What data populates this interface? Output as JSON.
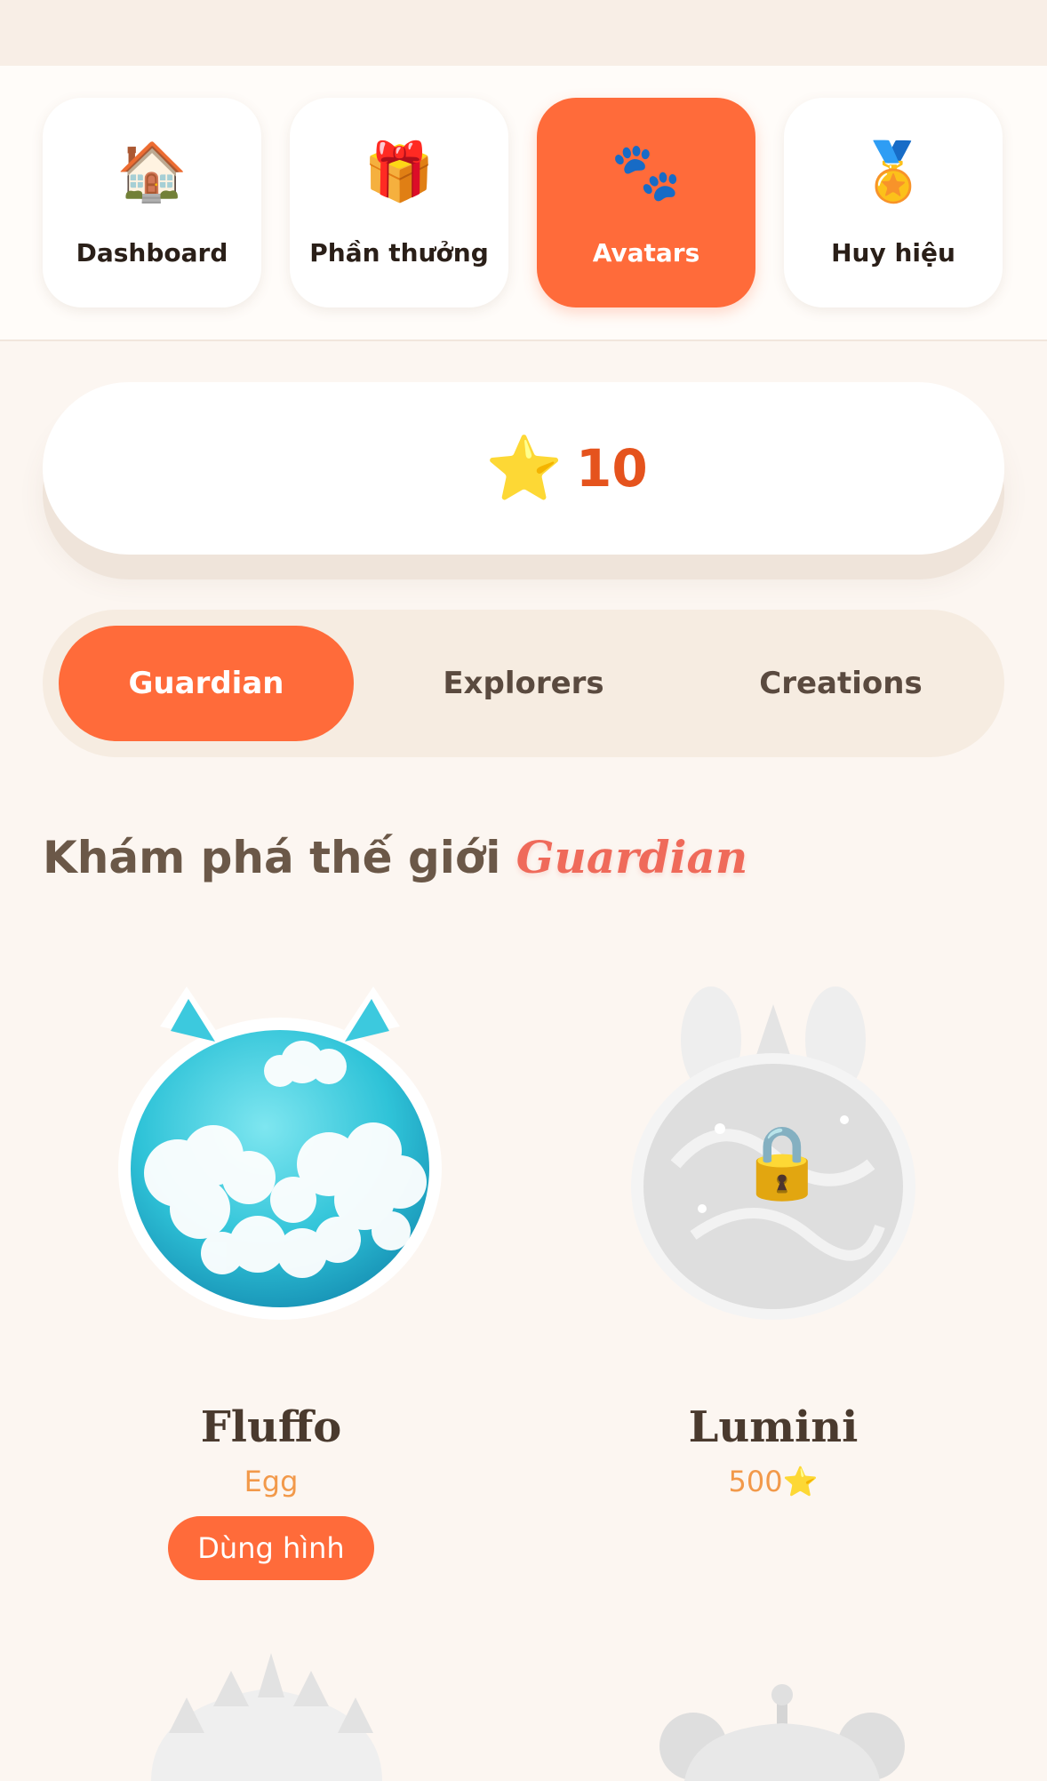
{
  "nav": {
    "items": [
      {
        "label": "Dashboard",
        "icon": "🏠",
        "icon_name": "house-icon",
        "active": false
      },
      {
        "label": "Phần thưởng",
        "icon": "🎁",
        "icon_name": "gift-icon",
        "active": false
      },
      {
        "label": "Avatars",
        "icon": "🐾",
        "icon_name": "paw-prints-icon",
        "active": true
      },
      {
        "label": "Huy hiệu",
        "icon": "🏅",
        "icon_name": "medal-icon",
        "active": false
      }
    ]
  },
  "stars": {
    "icon": "⭐",
    "icon_name": "star-icon",
    "count": "10"
  },
  "tabs": [
    {
      "label": "Guardian",
      "active": true
    },
    {
      "label": "Explorers",
      "active": false
    },
    {
      "label": "Creations",
      "active": false
    }
  ],
  "section": {
    "title_prefix": "Khám phá thế giới",
    "title_accent": "Guardian"
  },
  "avatars": [
    {
      "name": "Fluffo",
      "subtitle": "Egg",
      "button": "Dùng hình",
      "locked": false
    },
    {
      "name": "Lumini",
      "subtitle": "500⭐",
      "locked": true,
      "lock_icon": "🔒"
    }
  ],
  "colors": {
    "accent": "#ff6b3a",
    "background": "#fcf6f1",
    "star_count": "#e5531d",
    "subtitle": "#f2994a"
  }
}
